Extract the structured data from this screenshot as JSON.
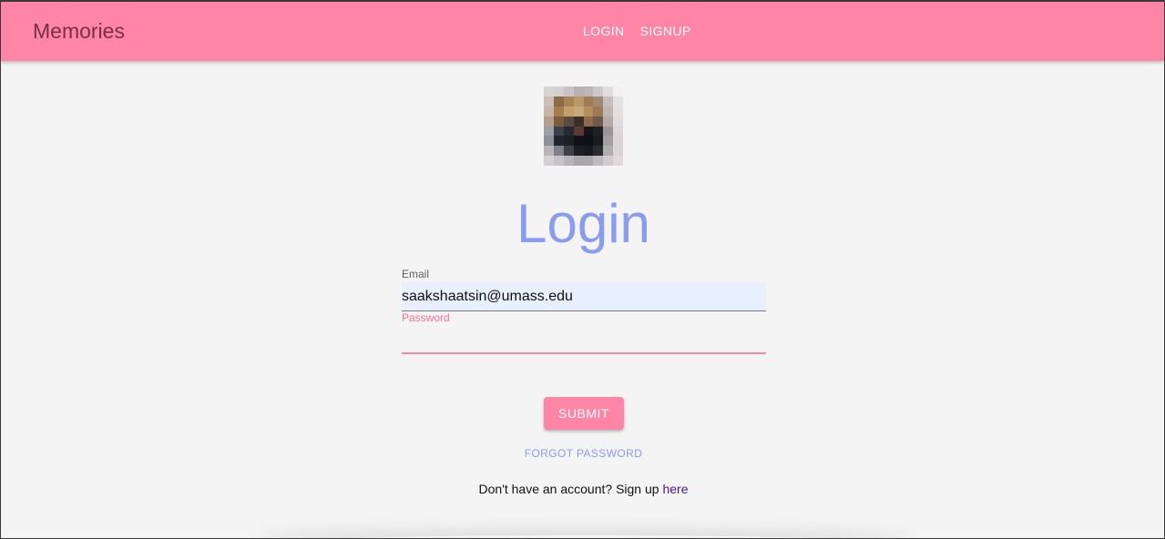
{
  "header": {
    "brand": "Memories",
    "nav": [
      {
        "label": "LOGIN"
      },
      {
        "label": "SIGNUP"
      }
    ],
    "color": "#ff85a6"
  },
  "main": {
    "avatar_icon": "pixelated-profile-image",
    "title": "Login",
    "email": {
      "label": "Email",
      "value": "saakshaatsin@umass.edu"
    },
    "password": {
      "label": "Password",
      "value": ""
    },
    "submit_label": "SUBMIT",
    "forgot_label": "FORGOT PASSWORD",
    "signup_prompt": "Don't have an account? Sign up ",
    "signup_link": "here"
  },
  "colors": {
    "accent": "#ff85a6",
    "title": "#8a9cee",
    "link": "#4a148c",
    "background": "#f4f4f4"
  }
}
